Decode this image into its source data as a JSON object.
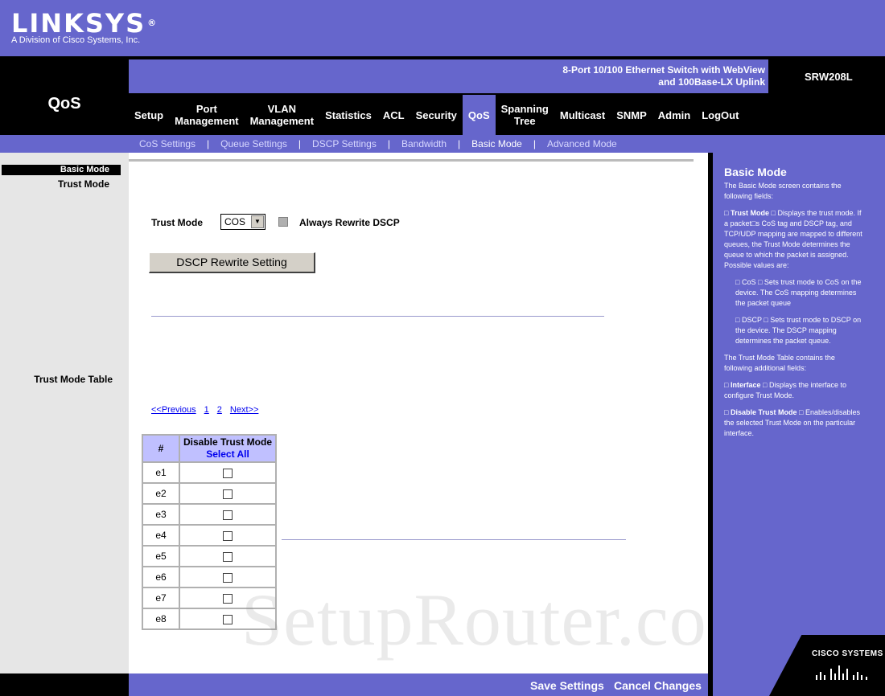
{
  "header": {
    "brand": "LINKSYS",
    "brand_mark": "®",
    "brand_sub": "A Division of Cisco Systems, Inc.",
    "section_title": "QoS",
    "product_line1": "8-Port 10/100 Ethernet Switch with WebView",
    "product_line2": "and 100Base-LX Uplink",
    "model": "SRW208L"
  },
  "tabs": [
    {
      "line1": "Setup",
      "line2": ""
    },
    {
      "line1": "Port",
      "line2": "Management"
    },
    {
      "line1": "VLAN",
      "line2": "Management"
    },
    {
      "line1": "Statistics",
      "line2": ""
    },
    {
      "line1": "ACL",
      "line2": ""
    },
    {
      "line1": "Security",
      "line2": ""
    },
    {
      "line1": "QoS",
      "line2": ""
    },
    {
      "line1": "Spanning",
      "line2": "Tree"
    },
    {
      "line1": "Multicast",
      "line2": ""
    },
    {
      "line1": "SNMP",
      "line2": ""
    },
    {
      "line1": "Admin",
      "line2": ""
    },
    {
      "line1": "LogOut",
      "line2": ""
    }
  ],
  "subtabs": [
    "CoS Settings",
    "Queue Settings",
    "DSCP Settings",
    "Bandwidth",
    "Basic Mode",
    "Advanced Mode"
  ],
  "subtab_separator": "|",
  "sidebar": {
    "basic_mode": "Basic Mode",
    "trust_mode": "Trust Mode",
    "trust_mode_table": "Trust Mode Table"
  },
  "form": {
    "trust_mode_label": "Trust Mode",
    "trust_mode_value": "COS",
    "always_rewrite_label": "Always Rewrite DSCP",
    "dscp_button": "DSCP Rewrite Setting"
  },
  "pager": {
    "prev": "<<Previous",
    "p1": "1",
    "p2": "2",
    "next": "Next>>"
  },
  "table": {
    "col_num": "#",
    "col_disable": "Disable Trust Mode",
    "select_all": "Select All",
    "rows": [
      "e1",
      "e2",
      "e3",
      "e4",
      "e5",
      "e6",
      "e7",
      "e8"
    ]
  },
  "help": {
    "title": "Basic Mode",
    "intro": "The Basic Mode screen contains the following fields:",
    "trust_term": "Trust Mode",
    "trust_desc": "Displays the trust mode. If a packet□s CoS tag and DSCP tag, and TCP/UDP mapping are mapped to different queues, the Trust Mode determines the queue to which the packet is assigned. Possible values are:",
    "cos_item": "CoS □ Sets trust mode to CoS on the device. The CoS mapping determines the packet queue",
    "dscp_item": "DSCP □ Sets trust mode to DSCP on the device. The DSCP mapping determines the packet queue.",
    "table_intro": "The Trust Mode Table contains the following additional fields:",
    "iface_term": "Interface",
    "iface_desc": "Displays the interface to configure Trust Mode.",
    "disable_term": "Disable Trust Mode",
    "disable_desc": "Enables/disables the selected Trust Mode on the particular interface.",
    "bullet": "□"
  },
  "footer": {
    "save": "Save Settings",
    "cancel": "Cancel Changes"
  },
  "watermark": "SetupRouter.com",
  "cisco": "CISCO SYSTEMS",
  "colors": {
    "accent": "#6666cc",
    "band": "#000000",
    "content": "#ffffff",
    "sidebar": "#e6e6e6",
    "table_header": "#c0c0ff"
  }
}
